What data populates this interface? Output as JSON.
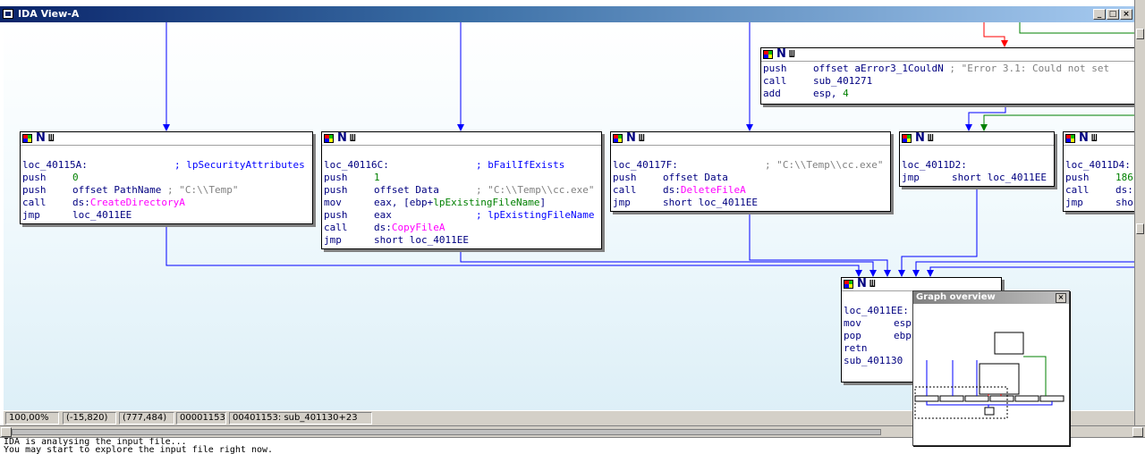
{
  "window": {
    "title": "IDA View-A"
  },
  "nodes": {
    "top_right": {
      "lines": [
        {
          "mn": "push",
          "op": "offset aError3_1CouldN",
          "cmt": "; \"Error 3.1: Could not set"
        },
        {
          "mn": "call",
          "op": "sub_401271"
        },
        {
          "mn": "add",
          "op": "esp, ",
          "num": "4"
        }
      ]
    },
    "n40115A": {
      "label": "loc_40115A:",
      "label_cmt": "; lpSecurityAttributes",
      "lines": [
        {
          "mn": "push",
          "num": "0"
        },
        {
          "mn": "push",
          "op": "offset PathName",
          "cmt": "; \"C:\\\\Temp\""
        },
        {
          "mn": "call",
          "seg": "ds:",
          "api": "CreateDirectoryA"
        },
        {
          "mn": "jmp",
          "op": "loc_4011EE"
        }
      ]
    },
    "n40116C": {
      "label": "loc_40116C:",
      "label_cmt": "; bFailIfExists",
      "lines": [
        {
          "mn": "push",
          "num": "1"
        },
        {
          "mn": "push",
          "op": "offset Data",
          "cmt": "; \"C:\\\\Temp\\\\cc.exe\""
        },
        {
          "mn": "mov",
          "op": "eax, [ebp+",
          "op2": "lpExistingFileName",
          "op3": "]"
        },
        {
          "mn": "push",
          "op": "eax",
          "cmt": "; lpExistingFileName"
        },
        {
          "mn": "call",
          "seg": "ds:",
          "api": "CopyFileA"
        },
        {
          "mn": "jmp",
          "op": "short loc_4011EE"
        }
      ]
    },
    "n40117F": {
      "label": "loc_40117F:",
      "label_cmt": "; \"C:\\\\Temp\\\\cc.exe\"",
      "lines": [
        {
          "mn": "push",
          "op": "offset Data"
        },
        {
          "mn": "call",
          "seg": "ds:",
          "api": "DeleteFileA"
        },
        {
          "mn": "jmp",
          "op": "short loc_4011EE"
        }
      ]
    },
    "n4011D2": {
      "label": "loc_4011D2:",
      "lines": [
        {
          "mn": "jmp",
          "op": "short loc_4011EE"
        }
      ]
    },
    "n4011D4": {
      "label": "loc_4011D4:",
      "lines": [
        {
          "mn": "push",
          "num": "186"
        },
        {
          "mn": "call",
          "seg": "ds:"
        },
        {
          "mn": "jmp",
          "op": "sho"
        }
      ]
    },
    "n4011EE": {
      "label": "loc_4011EE:",
      "lines": [
        {
          "mn": "mov",
          "op": "esp"
        },
        {
          "mn": "pop",
          "op": "ebp"
        },
        {
          "mn": "retn"
        },
        {
          "mn": "sub_401130",
          "op": ""
        }
      ]
    }
  },
  "status": {
    "zoom": "100,00%",
    "coords": "(-15,820)",
    "pos": "(777,484)",
    "offset": "00001153",
    "addr": "00401153: sub_401130+23"
  },
  "overview": {
    "title": "Graph overview"
  },
  "output": {
    "line1": "IDA is analysing the input file...",
    "line2": "You may start to explore the input file right now."
  },
  "colors": {
    "edge_blue": "#0000ff",
    "edge_red": "#ff0000",
    "edge_green": "#008000",
    "title_start": "#0a246a"
  }
}
